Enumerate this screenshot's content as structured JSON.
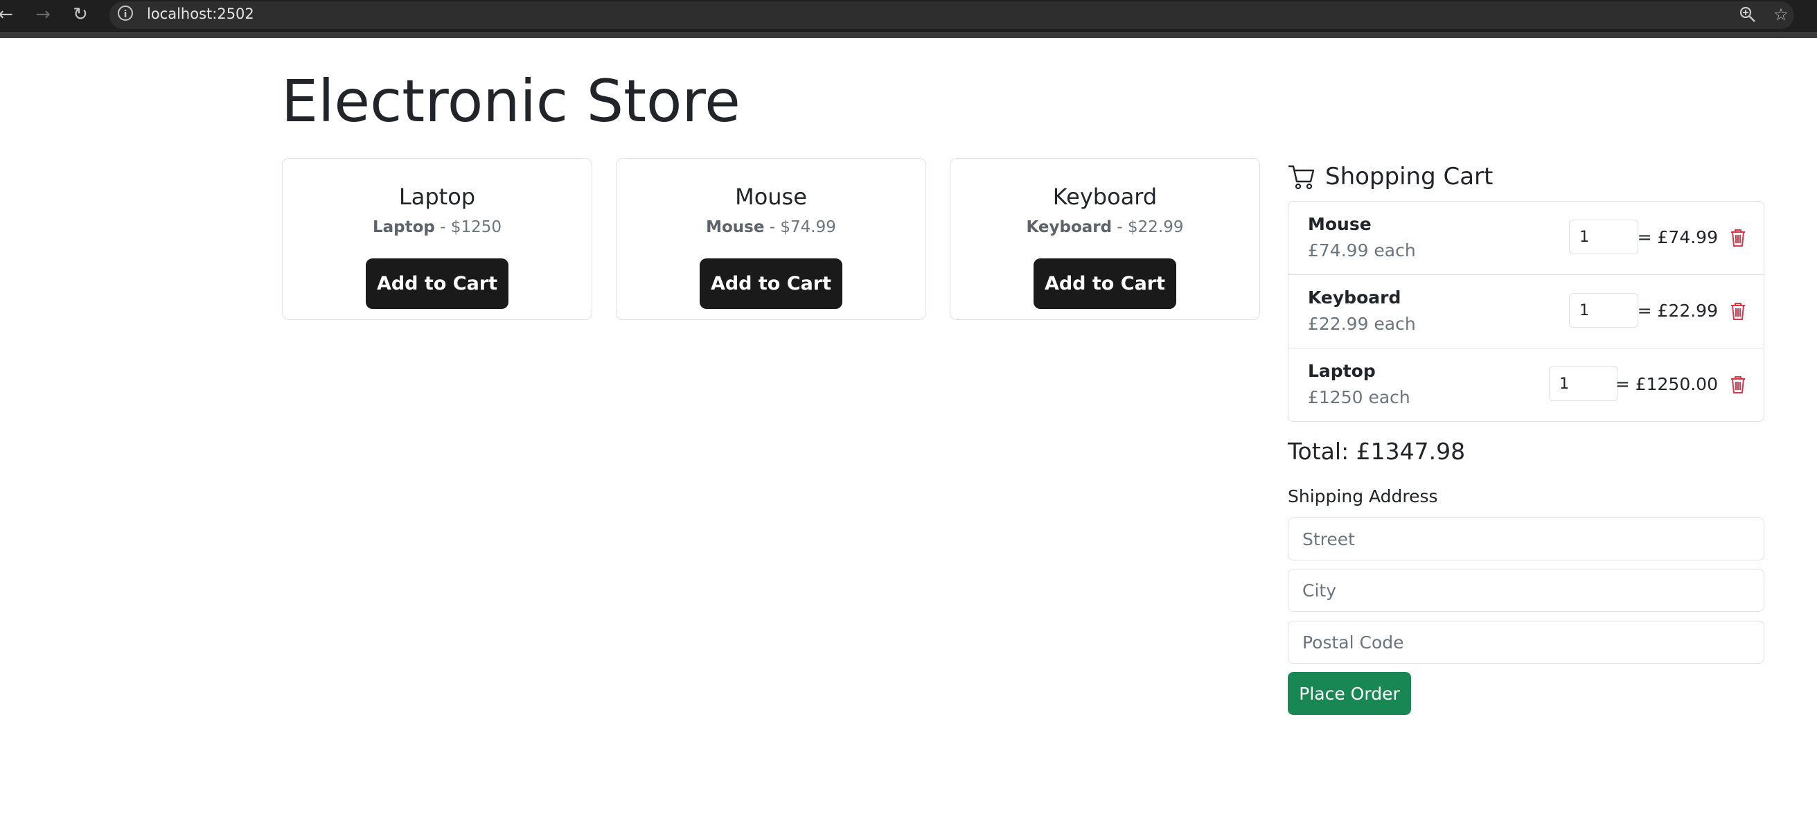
{
  "browser": {
    "url": "localhost:2502",
    "back_icon": "arrow-left-icon",
    "forward_icon": "arrow-right-icon",
    "reload_icon": "reload-icon",
    "info_icon": "info-icon",
    "zoom_icon": "zoom-icon",
    "bookmark_icon": "star-icon"
  },
  "page": {
    "title": "Electronic Store"
  },
  "products": [
    {
      "title": "Laptop",
      "name": "Laptop",
      "price": "$1250",
      "button": "Add to Cart"
    },
    {
      "title": "Mouse",
      "name": "Mouse",
      "price": "$74.99",
      "button": "Add to Cart"
    },
    {
      "title": "Keyboard",
      "name": "Keyboard",
      "price": "$22.99",
      "button": "Add to Cart"
    }
  ],
  "cart": {
    "title": "Shopping Cart",
    "icon": "shopping-cart-icon",
    "items": [
      {
        "name": "Mouse",
        "each": "£74.99 each",
        "qty": "1",
        "line_total": "= £74.99",
        "remove_icon": "trash-icon"
      },
      {
        "name": "Keyboard",
        "each": "£22.99 each",
        "qty": "1",
        "line_total": "= £22.99",
        "remove_icon": "trash-icon"
      },
      {
        "name": "Laptop",
        "each": "£1250 each",
        "qty": "1",
        "line_total": "= £1250.00",
        "remove_icon": "trash-icon"
      }
    ],
    "total": "Total: £1347.98"
  },
  "shipping": {
    "label": "Shipping Address",
    "street_placeholder": "Street",
    "city_placeholder": "City",
    "postal_placeholder": "Postal Code",
    "street_value": "",
    "city_value": "",
    "postal_value": ""
  },
  "order": {
    "button": "Place Order"
  },
  "colors": {
    "primary_dark": "#1a1a1a",
    "success": "#198754",
    "danger": "#dc3545",
    "border": "#dee2e6",
    "muted": "#6c757d"
  }
}
